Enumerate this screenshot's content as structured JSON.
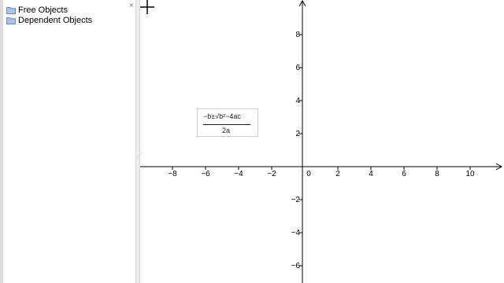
{
  "algebra_view": {
    "items": [
      {
        "label": "Free Objects",
        "icon": "folder-icon"
      },
      {
        "label": "Dependent Objects",
        "icon": "folder-icon"
      }
    ],
    "close_glyph": "×"
  },
  "splitter": {
    "grip_glyph": "⋰"
  },
  "graphics_view": {
    "x_ticks": [
      "−8",
      "−6",
      "−4",
      "−2",
      "0",
      "2",
      "4",
      "6",
      "8",
      "10"
    ],
    "y_ticks": [
      "8",
      "6",
      "4",
      "2",
      "−2",
      "−4",
      "−6"
    ],
    "axis_color": "#000000",
    "formula": {
      "numerator": "−b±√b²−4ac",
      "denominator": "2a"
    },
    "cursor": "crosshair-cursor"
  }
}
